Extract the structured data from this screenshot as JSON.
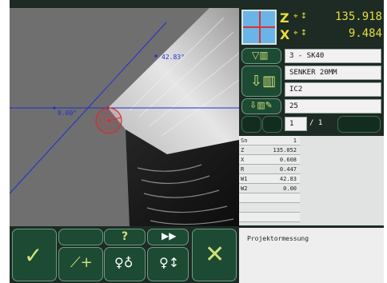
{
  "readout": {
    "z_axis": "Z",
    "z_value": "135.918",
    "x_axis": "X",
    "x_value": "9.484"
  },
  "overlay": {
    "angle_label": "42.83°",
    "zero_label": "0.00°"
  },
  "tool": {
    "name": "3 - SK40",
    "description": "SENKER 20MM",
    "code": "IC2",
    "number": "25",
    "page_current": "1",
    "page_total": "/ 1"
  },
  "data_table": {
    "rows": [
      {
        "label": "Sn",
        "value": "1"
      },
      {
        "label": "Z",
        "value": "135.052"
      },
      {
        "label": "X",
        "value": "0.608"
      },
      {
        "label": "R",
        "value": "0.447"
      },
      {
        "label": "W1",
        "value": "42.83"
      },
      {
        "label": "W2",
        "value": "0.00"
      },
      {
        "label": "",
        "value": ""
      },
      {
        "label": "",
        "value": ""
      },
      {
        "label": "",
        "value": ""
      }
    ]
  },
  "toolbar": {
    "help_label": "?"
  },
  "message": "Projektormessung",
  "colors": {
    "panel_bg": "#1d2b24",
    "button_green": "#1c4a33",
    "readout_yellow": "#e8df3a",
    "accent_yellow": "#d2e27a"
  }
}
